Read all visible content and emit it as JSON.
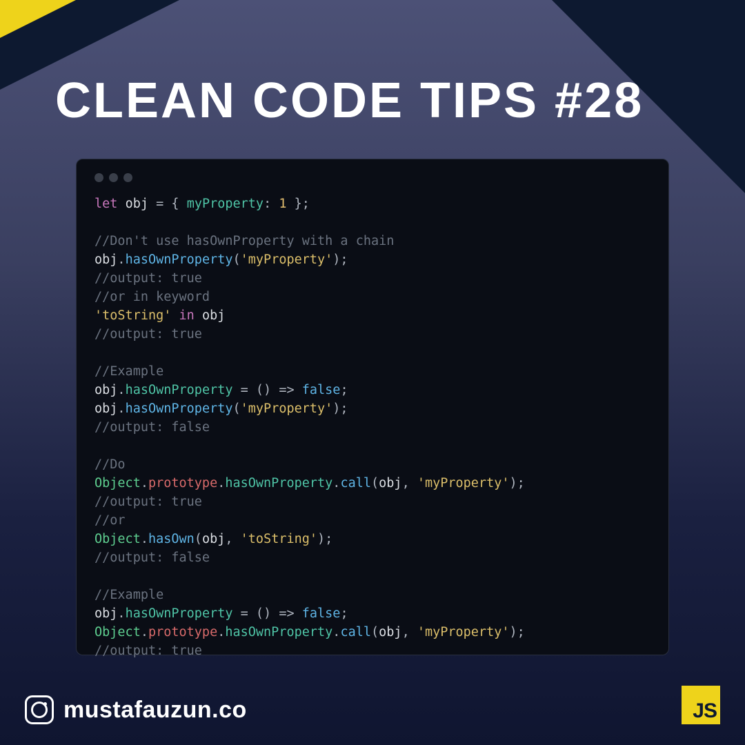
{
  "title": "CLEAN CODE TIPS #28",
  "footer": {
    "handle": "mustafauzun.co",
    "badge": "JS"
  },
  "code": {
    "lines": [
      [
        [
          "kw",
          "let"
        ],
        [
          "",
          ""
        ],
        [
          "",
          ""
        ],
        [
          "",
          ""
        ],
        [
          "",
          ""
        ],
        [
          "",
          ""
        ],
        [
          "",
          ""
        ]
      ],
      ""
    ],
    "tokens": [
      {
        "t": "kw",
        "v": "let "
      },
      {
        "t": "var",
        "v": "obj"
      },
      {
        "t": "punct",
        "v": " = { "
      },
      {
        "t": "prop",
        "v": "myProperty"
      },
      {
        "t": "punct",
        "v": ": "
      },
      {
        "t": "num",
        "v": "1"
      },
      {
        "t": "punct",
        "v": " };"
      },
      {
        "t": "nl"
      },
      {
        "t": "nl"
      },
      {
        "t": "comment",
        "v": "//Don't use hasOwnProperty with a chain"
      },
      {
        "t": "nl"
      },
      {
        "t": "var",
        "v": "obj"
      },
      {
        "t": "punct",
        "v": "."
      },
      {
        "t": "method",
        "v": "hasOwnProperty"
      },
      {
        "t": "punct",
        "v": "("
      },
      {
        "t": "str",
        "v": "'myProperty'"
      },
      {
        "t": "punct",
        "v": ");"
      },
      {
        "t": "nl"
      },
      {
        "t": "comment",
        "v": "//output: true"
      },
      {
        "t": "nl"
      },
      {
        "t": "comment",
        "v": "//or in keyword"
      },
      {
        "t": "nl"
      },
      {
        "t": "str",
        "v": "'toString'"
      },
      {
        "t": "punct",
        "v": " "
      },
      {
        "t": "kw",
        "v": "in"
      },
      {
        "t": "punct",
        "v": " "
      },
      {
        "t": "var",
        "v": "obj"
      },
      {
        "t": "nl"
      },
      {
        "t": "comment",
        "v": "//output: true"
      },
      {
        "t": "nl"
      },
      {
        "t": "nl"
      },
      {
        "t": "comment",
        "v": "//Example"
      },
      {
        "t": "nl"
      },
      {
        "t": "var",
        "v": "obj"
      },
      {
        "t": "punct",
        "v": "."
      },
      {
        "t": "prop",
        "v": "hasOwnProperty"
      },
      {
        "t": "punct",
        "v": " = () => "
      },
      {
        "t": "false",
        "v": "false"
      },
      {
        "t": "punct",
        "v": ";"
      },
      {
        "t": "nl"
      },
      {
        "t": "var",
        "v": "obj"
      },
      {
        "t": "punct",
        "v": "."
      },
      {
        "t": "method",
        "v": "hasOwnProperty"
      },
      {
        "t": "punct",
        "v": "("
      },
      {
        "t": "str",
        "v": "'myProperty'"
      },
      {
        "t": "punct",
        "v": ");"
      },
      {
        "t": "nl"
      },
      {
        "t": "comment",
        "v": "//output: false"
      },
      {
        "t": "nl"
      },
      {
        "t": "nl"
      },
      {
        "t": "comment",
        "v": "//Do"
      },
      {
        "t": "nl"
      },
      {
        "t": "class",
        "v": "Object"
      },
      {
        "t": "punct",
        "v": "."
      },
      {
        "t": "proto",
        "v": "prototype"
      },
      {
        "t": "punct",
        "v": "."
      },
      {
        "t": "prop",
        "v": "hasOwnProperty"
      },
      {
        "t": "punct",
        "v": "."
      },
      {
        "t": "method",
        "v": "call"
      },
      {
        "t": "punct",
        "v": "("
      },
      {
        "t": "var",
        "v": "obj"
      },
      {
        "t": "punct",
        "v": ", "
      },
      {
        "t": "str",
        "v": "'myProperty'"
      },
      {
        "t": "punct",
        "v": ");"
      },
      {
        "t": "nl"
      },
      {
        "t": "comment",
        "v": "//output: true"
      },
      {
        "t": "nl"
      },
      {
        "t": "comment",
        "v": "//or"
      },
      {
        "t": "nl"
      },
      {
        "t": "class",
        "v": "Object"
      },
      {
        "t": "punct",
        "v": "."
      },
      {
        "t": "method",
        "v": "hasOwn"
      },
      {
        "t": "punct",
        "v": "("
      },
      {
        "t": "var",
        "v": "obj"
      },
      {
        "t": "punct",
        "v": ", "
      },
      {
        "t": "str",
        "v": "'toString'"
      },
      {
        "t": "punct",
        "v": ");"
      },
      {
        "t": "nl"
      },
      {
        "t": "comment",
        "v": "//output: false"
      },
      {
        "t": "nl"
      },
      {
        "t": "nl"
      },
      {
        "t": "comment",
        "v": "//Example"
      },
      {
        "t": "nl"
      },
      {
        "t": "var",
        "v": "obj"
      },
      {
        "t": "punct",
        "v": "."
      },
      {
        "t": "prop",
        "v": "hasOwnProperty"
      },
      {
        "t": "punct",
        "v": " = () => "
      },
      {
        "t": "false",
        "v": "false"
      },
      {
        "t": "punct",
        "v": ";"
      },
      {
        "t": "nl"
      },
      {
        "t": "class",
        "v": "Object"
      },
      {
        "t": "punct",
        "v": "."
      },
      {
        "t": "proto",
        "v": "prototype"
      },
      {
        "t": "punct",
        "v": "."
      },
      {
        "t": "prop",
        "v": "hasOwnProperty"
      },
      {
        "t": "punct",
        "v": "."
      },
      {
        "t": "method",
        "v": "call"
      },
      {
        "t": "punct",
        "v": "("
      },
      {
        "t": "var",
        "v": "obj"
      },
      {
        "t": "punct",
        "v": ", "
      },
      {
        "t": "str",
        "v": "'myProperty'"
      },
      {
        "t": "punct",
        "v": ");"
      },
      {
        "t": "nl"
      },
      {
        "t": "comment",
        "v": "//output: true"
      }
    ]
  }
}
